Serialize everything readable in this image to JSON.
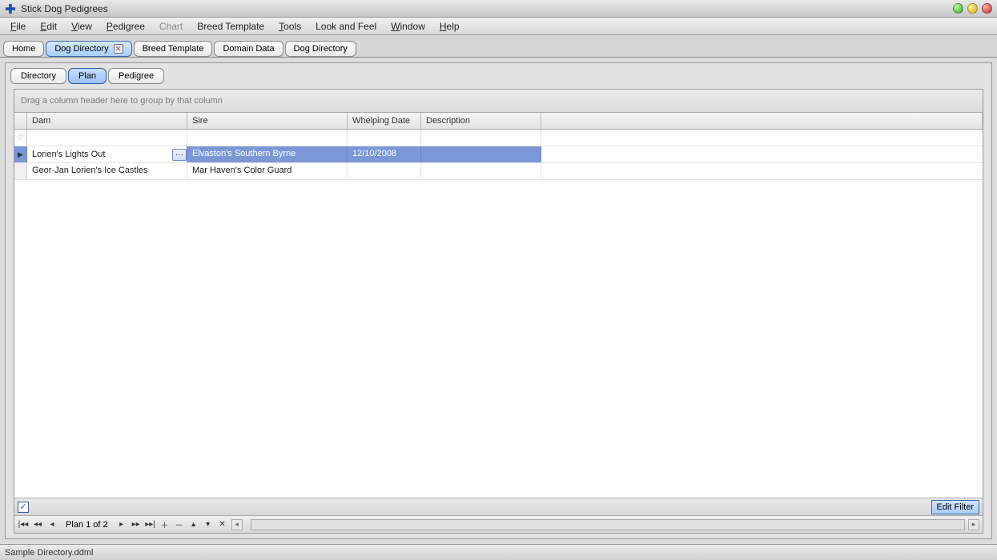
{
  "window": {
    "title": "Stick Dog Pedigrees"
  },
  "menu": {
    "file": "File",
    "edit": "Edit",
    "view": "View",
    "pedigree": "Pedigree",
    "chart": "Chart",
    "breed_template": "Breed Template",
    "tools": "Tools",
    "look_and_feel": "Look and Feel",
    "window": "Window",
    "help": "Help"
  },
  "doc_tabs": {
    "home": "Home",
    "dog_directory": "Dog Directory",
    "breed_template": "Breed Template",
    "domain_data": "Domain Data",
    "dog_directory2": "Dog Directory"
  },
  "sub_tabs": {
    "directory": "Directory",
    "plan": "Plan",
    "pedigree": "Pedigree"
  },
  "grid": {
    "group_hint": "Drag a column header here to group by that column",
    "headers": {
      "dam": "Dam",
      "sire": "Sire",
      "whelping_date": "Whelping Date",
      "description": "Description"
    },
    "rows": [
      {
        "dam": "Lorien's Lights Out",
        "sire": "Elvaston's Southern Byrne",
        "whelping_date": "12/10/2008",
        "description": ""
      },
      {
        "dam": "Geor-Jan Lorien's Ice Castles",
        "sire": "Mar Haven's Color Guard",
        "whelping_date": "",
        "description": ""
      }
    ],
    "ellipsis": "···"
  },
  "filter": {
    "edit_filter": "Edit Filter"
  },
  "navigator": {
    "position": "Plan 1 of 2"
  },
  "status": {
    "file": "Sample Directory.ddml"
  }
}
